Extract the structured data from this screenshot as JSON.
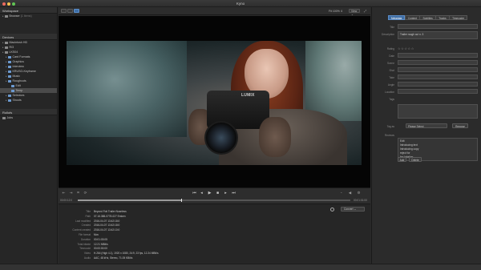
{
  "app": {
    "title": "Kyno"
  },
  "left_panel": {
    "workspace_header": "Workspace",
    "browser_item": "Browser",
    "browser_count": "(1 items)",
    "devices_header": "Devices",
    "tree": [
      {
        "label": "Macintosh HD",
        "icon": "drive-icon",
        "depth": 0
      },
      {
        "label": "R/3",
        "icon": "drive-icon",
        "depth": 0
      },
      {
        "label": "LKS04",
        "icon": "drive-icon",
        "depth": 0
      },
      {
        "label": "Card Formats",
        "icon": "folder-icon",
        "depth": 1
      },
      {
        "label": "Graphics",
        "icon": "folder-icon",
        "depth": 1
      },
      {
        "label": "Interview",
        "icon": "folder-icon",
        "depth": 1
      },
      {
        "label": "KRUSO-Keyframe",
        "icon": "folder-icon",
        "depth": 1
      },
      {
        "label": "Music",
        "icon": "folder-icon",
        "depth": 1
      },
      {
        "label": "Roughcuts",
        "icon": "folder-icon",
        "depth": 1
      },
      {
        "label": "Edit",
        "icon": "folder-icon",
        "depth": 2
      },
      {
        "label": "Temp",
        "icon": "folder-icon",
        "depth": 2
      },
      {
        "label": "Selectors",
        "icon": "folder-icon",
        "depth": 1
      },
      {
        "label": "Shoots",
        "icon": "folder-icon",
        "depth": 1
      }
    ],
    "rollouts_header": "Rollofs",
    "jobs_item": "Jobs"
  },
  "center_header": {
    "fit_label": "Fit 100% ⇕",
    "view_label": "View ⌄"
  },
  "video": {
    "camera_brand": "LUMIX"
  },
  "controls": {
    "time_start": "00:00:12:0",
    "time_end": "00:01:01:00"
  },
  "scrub": {
    "progress": 0.38
  },
  "metadata": {
    "convert_label": "Convert ⌄",
    "rows": [
      {
        "key": "Title",
        "value": "Beyond Foti Trailer Noseless"
      },
      {
        "key": "Path",
        "value": "07.16.388-0778-027 Emken"
      },
      {
        "key": "Last modified",
        "value": "2016-04-07 13:42:18:0"
      },
      {
        "key": "Created",
        "value": "2016-04-07 13:42:18:0"
      },
      {
        "key": "Content created",
        "value": "2016-04-07 13:42:10:0"
      },
      {
        "key": "File format",
        "value": "Mov"
      },
      {
        "key": "Duration",
        "value": "00:01:03:05"
      },
      {
        "key": "Total bitrate",
        "value": "12.21 MBit/s"
      },
      {
        "key": "Timecode",
        "value": "00:00:00:00"
      },
      {
        "key": "Video",
        "value": "H.264 (High 4.1), 1920 x 1080, 24:9, 23 fps, 12.24 MBit/s"
      },
      {
        "key": "Audio",
        "value": "AAC, 48 kHz, Stereo, 71.05 KBit/s"
      }
    ]
  },
  "right_panel": {
    "tabs": [
      "Metadata",
      "Content",
      "Subtitles",
      "Tracks",
      "Timecoder"
    ],
    "active_tab": 0,
    "fields": [
      {
        "label": "Title",
        "value": ""
      },
      {
        "label": "Description",
        "value": "Trailer rough cut n. 3"
      },
      {
        "label": "Rating",
        "value": "☆☆☆☆☆"
      },
      {
        "label": "Date",
        "value": ""
      },
      {
        "label": "Scene",
        "value": ""
      },
      {
        "label": "Shot",
        "value": ""
      },
      {
        "label": "Take",
        "value": ""
      },
      {
        "label": "Angle",
        "value": ""
      },
      {
        "label": "Location",
        "value": ""
      },
      {
        "label": "Tags",
        "value": ""
      }
    ],
    "tag_as_label": "Tag as",
    "tag_placeholder": "Please Select",
    "remove_label": "Remove",
    "reviews_label": "Reviews",
    "reviews": [
      "Edit",
      "Introducing text",
      "Introducing copy",
      "reject for",
      "fan labeling"
    ],
    "add_label": "Add",
    "delete_label": "Delete"
  },
  "colors": {
    "accent": "#3f6ea5",
    "background": "#2a2a2a",
    "panel": "#262626",
    "video_black": "#050505"
  }
}
